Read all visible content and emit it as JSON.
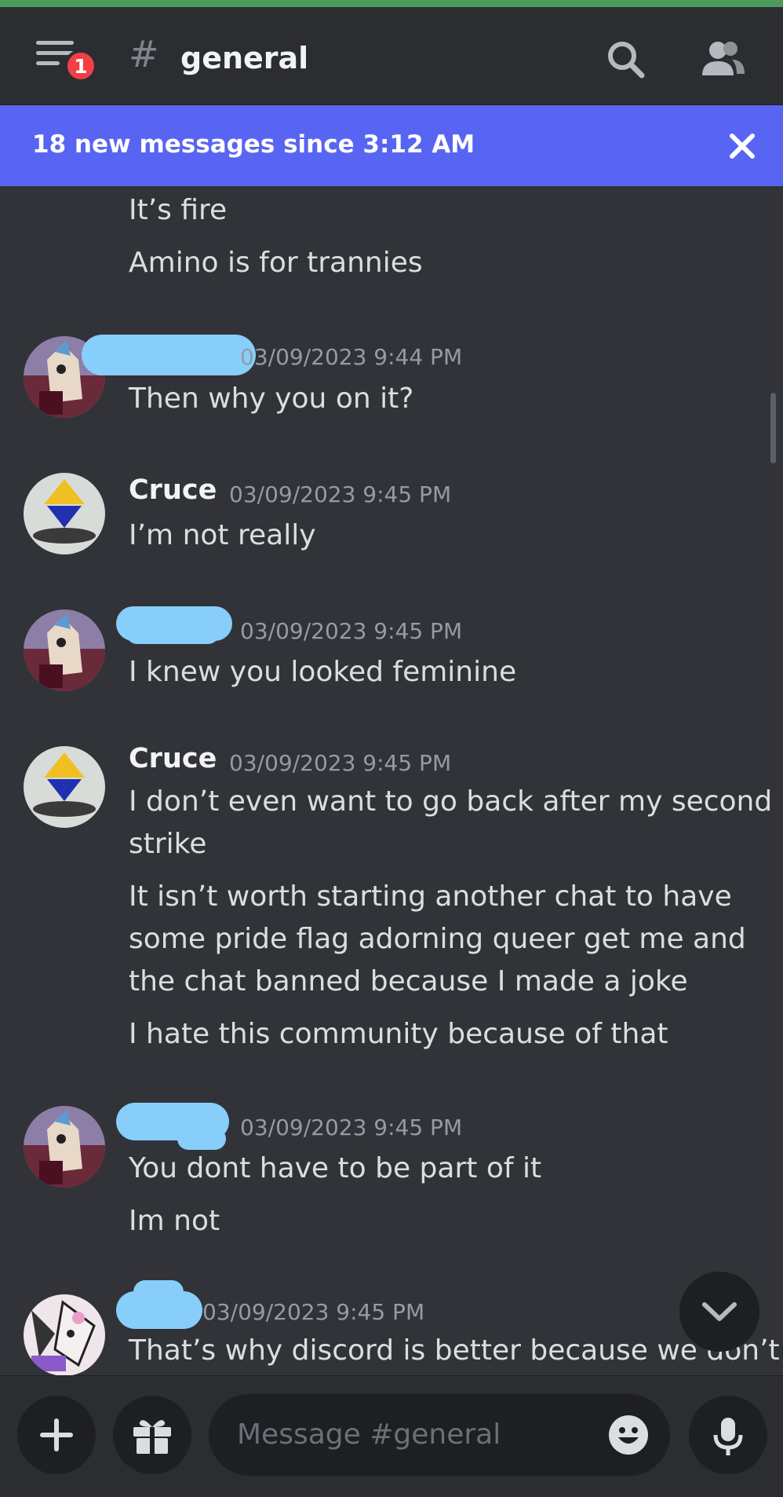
{
  "header": {
    "notification_count": "1",
    "channel_hash": "#",
    "channel_name": "general"
  },
  "banner": {
    "text": "18 new messages since 3:12 AM"
  },
  "messages": [
    {
      "lines": [
        "It’s fire",
        "Amino is for trannies"
      ]
    },
    {
      "author": "",
      "timestamp": "03/09/2023 9:44 PM",
      "lines": [
        "Then why you on it?"
      ]
    },
    {
      "author": "Cruce",
      "timestamp": "03/09/2023 9:45 PM",
      "lines": [
        "I’m not really"
      ]
    },
    {
      "author": "",
      "timestamp": "03/09/2023 9:45 PM",
      "lines": [
        "I knew you looked feminine"
      ]
    },
    {
      "author": "Cruce",
      "timestamp": "03/09/2023 9:45 PM",
      "lines": [
        "I don’t even want to go back after my second",
        "strike",
        "It isn’t worth starting another chat to have",
        "some pride flag adorning queer get me and",
        "the chat banned because I made a joke",
        "I hate this community because of that"
      ]
    },
    {
      "author": "",
      "timestamp": "03/09/2023 9:45 PM",
      "lines": [
        "You dont have to be part of it",
        "Im not"
      ]
    },
    {
      "author": "",
      "timestamp": "03/09/2023 9:45 PM",
      "lines": [
        "That’s why discord is better because we don’t"
      ]
    }
  ],
  "composer": {
    "placeholder": "Message #general"
  },
  "colors": {
    "background": "#313338",
    "header": "#2b2d31",
    "banner": "#5865f2",
    "badge": "#f23f43",
    "redaction": "#87cefa"
  },
  "icons": [
    "menu-icon",
    "search-icon",
    "members-icon",
    "close-icon",
    "chevron-down-icon",
    "plus-icon",
    "gift-icon",
    "emoji-icon",
    "microphone-icon"
  ]
}
